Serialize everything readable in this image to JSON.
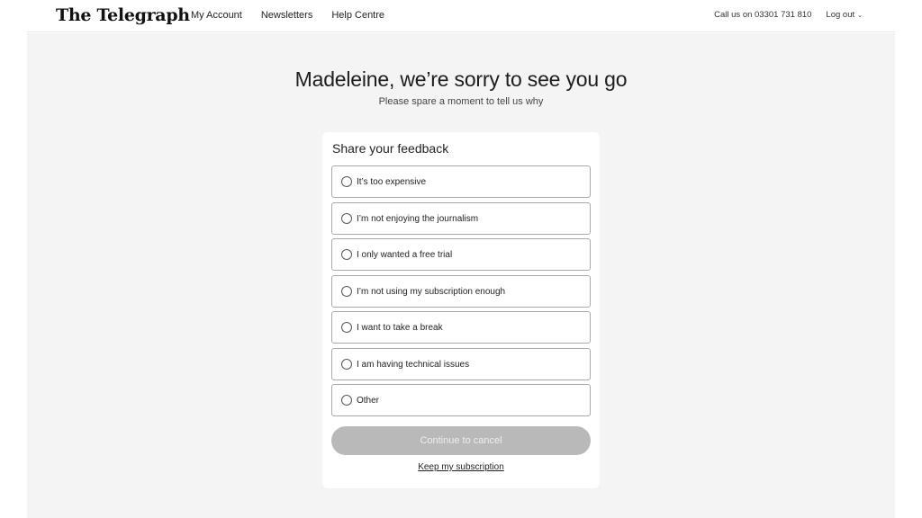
{
  "header": {
    "logo": "The Telegraph",
    "nav": [
      "My Account",
      "Newsletters",
      "Help Centre"
    ],
    "phone": "Call us on 03301 731 810",
    "logout": "Log out"
  },
  "main": {
    "heading": "Madeleine, we’re sorry to see you go",
    "subheading": "Please spare a moment to tell us why"
  },
  "feedback": {
    "title": "Share your feedback",
    "options": [
      "It’s too expensive",
      "I’m not enjoying the journalism",
      "I only wanted a free trial",
      "I’m not using my subscription enough",
      "I want to take a break",
      "I am having technical issues",
      "Other"
    ],
    "continue_label": "Continue to cancel",
    "keep_label": "Keep my subscription"
  }
}
